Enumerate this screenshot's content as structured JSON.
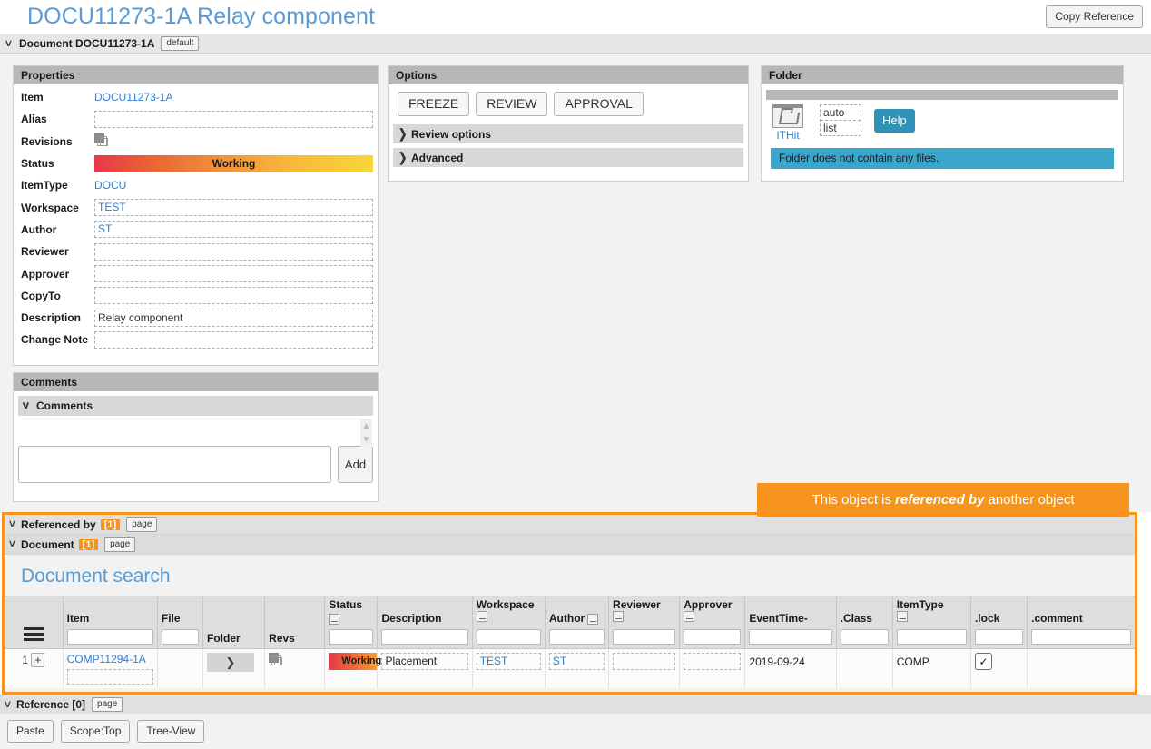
{
  "header": {
    "page_title": "DOCU11273-1A Relay component",
    "copy_reference_label": "Copy Reference",
    "doc_label": "Document DOCU11273-1A",
    "doc_tag": "default"
  },
  "properties": {
    "panel_title": "Properties",
    "rows": [
      {
        "label": "Item",
        "value": "DOCU11273-1A",
        "kind": "link"
      },
      {
        "label": "Alias",
        "value": "",
        "kind": "dash"
      },
      {
        "label": "Revisions",
        "value": "",
        "kind": "icon"
      },
      {
        "label": "Status",
        "value": "Working",
        "kind": "status"
      },
      {
        "label": "ItemType",
        "value": "DOCU",
        "kind": "link"
      },
      {
        "label": "Workspace",
        "value": "TEST",
        "kind": "dash"
      },
      {
        "label": "Author",
        "value": "ST",
        "kind": "dash"
      },
      {
        "label": "Reviewer",
        "value": "",
        "kind": "dash"
      },
      {
        "label": "Approver",
        "value": "",
        "kind": "dash"
      },
      {
        "label": "CopyTo",
        "value": "",
        "kind": "dash"
      },
      {
        "label": "Description",
        "value": "Relay component",
        "kind": "dashdark"
      },
      {
        "label": "Change Note",
        "value": "",
        "kind": "dash"
      }
    ]
  },
  "options": {
    "panel_title": "Options",
    "buttons": [
      "FREEZE",
      "REVIEW",
      "APPROVAL"
    ],
    "accordions": [
      "Review options",
      "Advanced"
    ]
  },
  "folder": {
    "panel_title": "Folder",
    "link_label": "ITHit",
    "auto_label": "auto",
    "list_label": "list",
    "help_label": "Help",
    "message": "Folder does not contain any files."
  },
  "comments": {
    "panel_title": "Comments",
    "section_title": "Comments",
    "input_value": "",
    "input_placeholder": "",
    "add_label": "Add"
  },
  "tooltip": {
    "prefix": "This object is",
    "emphasis": "referenced by",
    "suffix": "another object"
  },
  "referenced_by": {
    "label": "Referenced by",
    "count": "[1]",
    "page_tag": "page",
    "sub_label": "Document",
    "sub_count": "[1]",
    "sub_page_tag": "page",
    "search_title": "Document search"
  },
  "table": {
    "columns": [
      {
        "key": "menu",
        "label": "",
        "filter": false,
        "opt": false
      },
      {
        "key": "item",
        "label": "Item",
        "filter": true,
        "opt": false
      },
      {
        "key": "file",
        "label": "File",
        "filter": true,
        "opt": false
      },
      {
        "key": "folder",
        "label": "Folder",
        "filter": false,
        "opt": false
      },
      {
        "key": "revs",
        "label": "Revs",
        "filter": false,
        "opt": false
      },
      {
        "key": "status",
        "label": "Status",
        "filter": true,
        "opt": true
      },
      {
        "key": "description",
        "label": "Description",
        "filter": true,
        "opt": false
      },
      {
        "key": "workspace",
        "label": "Workspace",
        "filter": true,
        "opt": true
      },
      {
        "key": "author",
        "label": "Author",
        "filter": true,
        "opt": true
      },
      {
        "key": "reviewer",
        "label": "Reviewer",
        "filter": true,
        "opt": true
      },
      {
        "key": "approver",
        "label": "Approver",
        "filter": true,
        "opt": true
      },
      {
        "key": "eventtime",
        "label": "EventTime-",
        "filter": true,
        "opt": false
      },
      {
        "key": "class",
        "label": ".Class",
        "filter": true,
        "opt": false
      },
      {
        "key": "itemtype",
        "label": "ItemType",
        "filter": true,
        "opt": true
      },
      {
        "key": "lock",
        "label": ".lock",
        "filter": true,
        "opt": false
      },
      {
        "key": "comment",
        "label": ".comment",
        "filter": true,
        "opt": false
      }
    ],
    "rows": [
      {
        "num": "1",
        "expand": "+",
        "item": "COMP11294-1A",
        "file": "",
        "folder_arrow": "❯",
        "status": "Working",
        "description": "Placement",
        "workspace": "TEST",
        "author": "ST",
        "reviewer": "",
        "approver": "",
        "eventtime": "2019-09-24",
        "class": "",
        "itemtype": "COMP",
        "lock": "✓",
        "comment": ""
      }
    ]
  },
  "reference_section": {
    "label": "Reference [0]",
    "page_tag": "page"
  },
  "bottom_buttons": [
    "Paste",
    "Scope:Top",
    "Tree-View"
  ],
  "colors": {
    "accent_blue": "#5b9bd5",
    "orange": "#f7941e",
    "teal": "#3ba6cc",
    "status_start": "#e5394a",
    "status_end": "#f9d53a"
  }
}
